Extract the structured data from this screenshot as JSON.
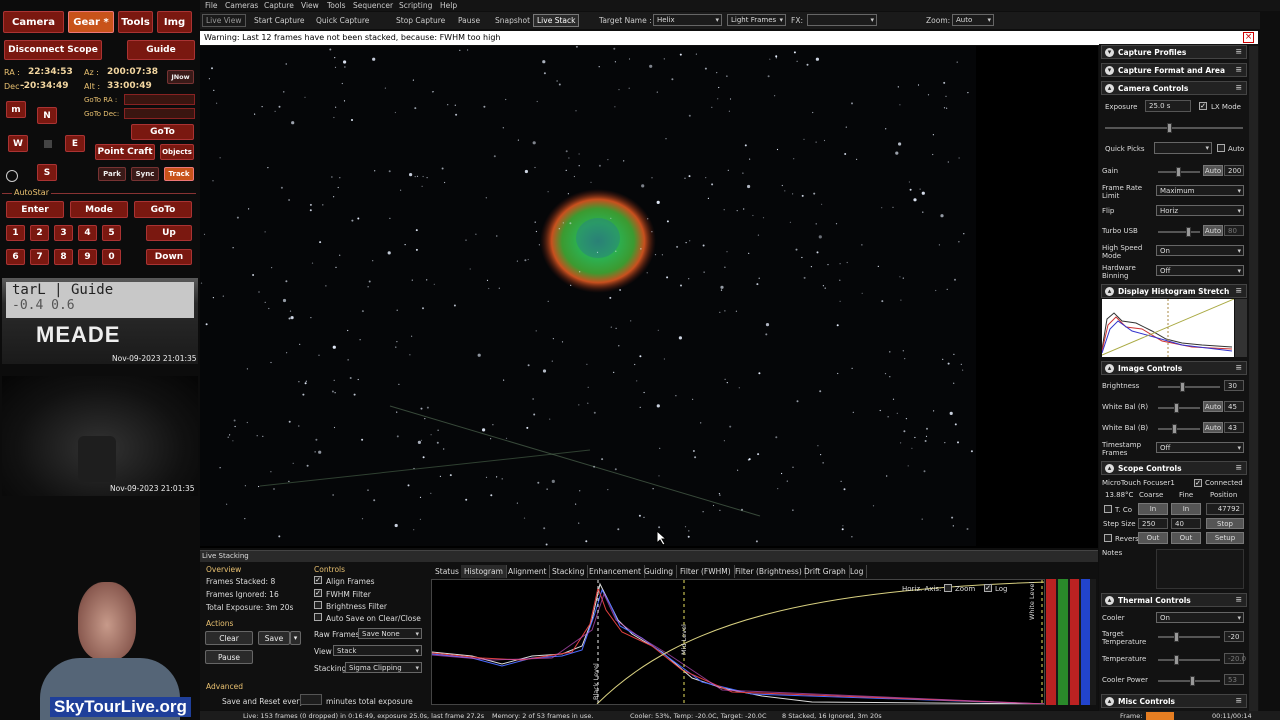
{
  "left_tabs": [
    {
      "label": "Camera"
    },
    {
      "label": "Gear *"
    },
    {
      "label": "Tools"
    },
    {
      "label": "Img"
    }
  ],
  "scope": {
    "disconnect_label": "Disconnect Scope",
    "guide_label": "Guide",
    "ra_label": "RA :",
    "ra_value": "22:34:53",
    "az_label": "Az :",
    "az_value": "200:07:38",
    "now_label": "JNow",
    "dec_label": "Dec :",
    "dec_value": "-20:34:49",
    "alt_label": "Alt :",
    "alt_value": "33:00:49",
    "goto_ra_label": "GoTo RA :",
    "goto_dec_label": "GoTo Dec:",
    "goto_label": "GoTo",
    "m_label": "m",
    "n_label": "N",
    "w_label": "W",
    "e_label": "E",
    "s_label": "S",
    "point_craft_label": "Point Craft",
    "objects_label": "Objects",
    "park_label": "Park",
    "sync_label": "Sync",
    "track_label": "Track",
    "autostar_label": "AutoStar",
    "enter_label": "Enter",
    "mode_label": "Mode",
    "goto2_label": "GoTo",
    "keys": [
      "1",
      "2",
      "3",
      "4",
      "5",
      "6",
      "7",
      "8",
      "9",
      "0"
    ],
    "up_label": "Up",
    "down_label": "Down"
  },
  "webcam": {
    "top_text": "tarL | Guide",
    "top_sub": "-0.4   0.6",
    "brand": "MEADE",
    "timestamp1": "Nov-09-2023 21:01:35",
    "timestamp2": "Nov-09-2023 21:01:35"
  },
  "menu": [
    "File",
    "Cameras",
    "Capture",
    "View",
    "Tools",
    "Sequencer",
    "Scripting",
    "Help"
  ],
  "toolbar": {
    "live_view": "Live View",
    "start_capture": "Start Capture",
    "quick_capture": "Quick Capture",
    "stop_capture": "Stop Capture",
    "pause": "Pause",
    "snapshot": "Snapshot",
    "live_stack": "Live Stack",
    "target_label": "Target Name :",
    "target_value": "Helix",
    "frame_type": "Light Frames",
    "fx_label": "FX:",
    "fx_value": "",
    "zoom_label": "Zoom:",
    "zoom_value": "Auto"
  },
  "warning": "Warning: Last 12 frames have not been stacked, because: FWHM too high",
  "camera_panels": {
    "capture_profiles": "Capture Profiles",
    "capture_format": "Capture Format and Area",
    "camera_controls": "Camera Controls",
    "exposure_label": "Exposure",
    "exposure_value": "25.0 s",
    "lx_mode": "LX Mode",
    "quick_picks": "Quick Picks",
    "auto_label": "Auto",
    "gain_label": "Gain",
    "gain_value": "200",
    "frame_rate_label": "Frame Rate Limit",
    "frame_rate_value": "Maximum",
    "flip_label": "Flip",
    "flip_value": "Horiz",
    "turbo_label": "Turbo USB",
    "turbo_value": "80",
    "hispeed_label": "High Speed Mode",
    "hispeed_value": "On",
    "binning_label": "Hardware Binning",
    "binning_value": "Off",
    "histogram_stretch": "Display Histogram Stretch",
    "image_controls": "Image Controls",
    "brightness_label": "Brightness",
    "brightness_value": "30",
    "wbr_label": "White Bal (R)",
    "wbr_value": "45",
    "wbb_label": "White Bal (B)",
    "wbb_value": "43",
    "timestamp_label": "Timestamp Frames",
    "timestamp_value": "Off",
    "scope_controls": "Scope Controls",
    "focuser_name": "MicroTouch Focuser1",
    "connected": "Connected",
    "temp": "13.88°C",
    "coarse": "Coarse",
    "fine": "Fine",
    "position": "Position",
    "tco": "T. Co",
    "in1": "In",
    "in2": "In",
    "position_value": "47792",
    "step_size": "Step Size",
    "step1": "250",
    "step2": "40",
    "stop": "Stop",
    "reverse": "Revers",
    "out1": "Out",
    "out2": "Out",
    "setup": "Setup",
    "notes": "Notes",
    "thermal_controls": "Thermal Controls",
    "cooler_label": "Cooler",
    "cooler_value": "On",
    "target_temp_label": "Target Temperature",
    "target_temp_value": "-20",
    "temperature_label": "Temperature",
    "temperature_value": "-20.0",
    "cooler_power_label": "Cooler Power",
    "cooler_power_value": "53",
    "misc_controls": "Misc Controls"
  },
  "live_stacking": {
    "title": "Live Stacking",
    "overview": "Overview",
    "frames_stacked": "Frames Stacked: 8",
    "frames_ignored": "Frames Ignored: 16",
    "total_exposure": "Total Exposure:  3m 20s",
    "actions": "Actions",
    "clear": "Clear",
    "save": "Save",
    "pause": "Pause",
    "advanced": "Advanced",
    "save_reset": "Save and Reset every",
    "minutes": "minutes total exposure",
    "controls": "Controls",
    "align_frames": "Align Frames",
    "fwhm_filter": "FWHM Filter",
    "brightness_filter": "Brightness Filter",
    "auto_save": "Auto Save on Clear/Close",
    "raw_frames_label": "Raw Frames",
    "raw_frames_value": "Save None",
    "view_label": "View",
    "view_value": "Stack",
    "stacking_label": "Stacking",
    "stacking_value": "Sigma Clipping",
    "tabs": [
      "Status",
      "Histogram",
      "Alignment",
      "Stacking",
      "Enhancement",
      "Guiding",
      "Filter (FWHM)",
      "Filter (Brightness)",
      "Drift Graph",
      "Log"
    ],
    "horiz_axis": "Horiz. Axis:",
    "zoom": "Zoom",
    "log": "Log",
    "black_level": "Black Level",
    "mid_level": "Mid Level",
    "white_level": "White Level"
  },
  "status_bar": {
    "left": "Live: 153 frames (0 dropped) in 0:16:49, exposure 25.0s, last frame 27.2s",
    "memory": "Memory: 2 of 53 frames in use.",
    "cooler": "Cooler: 53%, Temp: -20.0C, Target: -20.0C",
    "stacked": "8 Stacked, 16 Ignored, 3m 20s",
    "frame_label": "Frame:",
    "time": "00:11/00:14"
  },
  "watermark": "SkyTourLive.org"
}
